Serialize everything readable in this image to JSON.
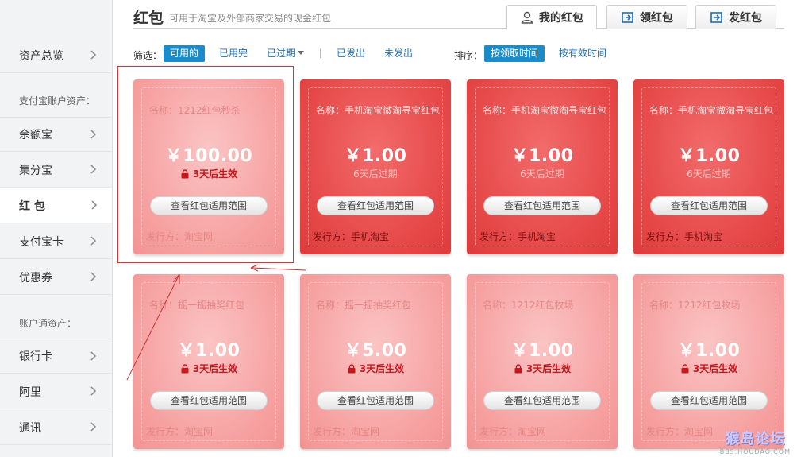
{
  "sidebar": {
    "items": [
      {
        "label": "资产总览"
      },
      {
        "label": "余额宝"
      },
      {
        "label": "集分宝"
      },
      {
        "label": "红 包"
      },
      {
        "label": "支付宝卡"
      },
      {
        "label": "优惠券"
      },
      {
        "label": "银行卡"
      },
      {
        "label": "阿里"
      },
      {
        "label": "通讯"
      }
    ],
    "section_alipay": "支付宝账户资产：",
    "section_account": "账户通资产："
  },
  "header": {
    "title": "红包",
    "subtitle": "可用于淘宝及外部商家交易的现金红包",
    "tabs": [
      {
        "label": "我的红包",
        "icon": "user-icon"
      },
      {
        "label": "领红包",
        "icon": "receive-envelope-icon"
      },
      {
        "label": "发红包",
        "icon": "send-envelope-icon"
      }
    ]
  },
  "filters": {
    "label": "筛选：",
    "options": [
      "可用的",
      "已用完",
      "已过期",
      "已发出",
      "未发出"
    ],
    "selected": "可用的"
  },
  "sort": {
    "label": "排序：",
    "options": [
      "按领取时间",
      "按有效时间"
    ],
    "selected": "按领取时间"
  },
  "cards": [
    {
      "name": "名称：1212红包秒杀",
      "amount": "￥100.00",
      "status": "3天后生效",
      "button": "查看红包适用范围",
      "issuer": "发行方：淘宝网"
    },
    {
      "name": "名称：手机淘宝微淘寻宝红包",
      "amount": "￥1.00",
      "status": "6天后过期",
      "button": "查看红包适用范围",
      "issuer": "发行方：手机淘宝"
    },
    {
      "name": "名称：手机淘宝微淘寻宝红包",
      "amount": "￥1.00",
      "status": "6天后过期",
      "button": "查看红包适用范围",
      "issuer": "发行方：手机淘宝"
    },
    {
      "name": "名称：手机淘宝微淘寻宝红包",
      "amount": "￥1.00",
      "status": "6天后过期",
      "button": "查看红包适用范围",
      "issuer": "发行方：手机淘宝"
    },
    {
      "name": "名称：摇一摇抽奖红包",
      "amount": "￥1.00",
      "status": "3天后生效",
      "button": "查看红包适用范围",
      "issuer": "发行方：淘宝网"
    },
    {
      "name": "名称：摇一摇抽奖红包",
      "amount": "￥5.00",
      "status": "3天后生效",
      "button": "查看红包适用范围",
      "issuer": "发行方：淘宝网"
    },
    {
      "name": "名称：1212红包牧场",
      "amount": "￥1.00",
      "status": "3天后生效",
      "button": "查看红包适用范围",
      "issuer": "发行方：淘宝网"
    },
    {
      "name": "名称：1212红包牧场",
      "amount": "￥1.00",
      "status": "3天后生效",
      "button": "查看红包适用范围",
      "issuer": "发行方：淘宝网"
    }
  ],
  "watermark": {
    "main": "猴岛论坛",
    "sub": "BBS.HOUDAO.COM"
  },
  "colors": {
    "accent": "#1a8ccc",
    "card_active": "#e74a4a",
    "card_pending": "#f6a0a0",
    "status_red": "#c8161e"
  }
}
